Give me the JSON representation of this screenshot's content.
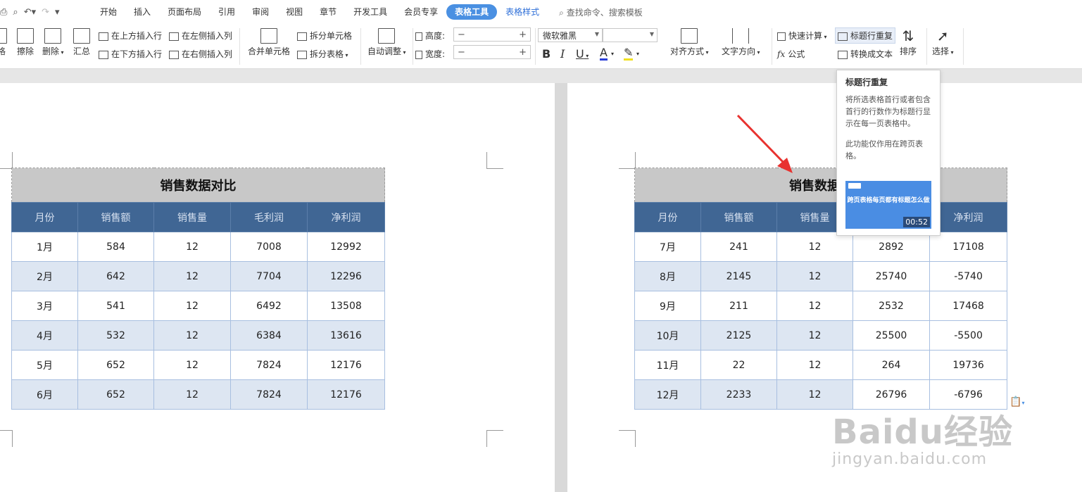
{
  "menubar": {
    "tabs": [
      "开始",
      "插入",
      "页面布局",
      "引用",
      "审阅",
      "视图",
      "章节",
      "开发工具",
      "会员专享",
      "表格工具",
      "表格样式"
    ],
    "active_tab": "表格工具",
    "search_text": "查找命令、搜索模板"
  },
  "ribbon": {
    "cut_label": "格",
    "erase_label": "擦除",
    "delete_label": "删除",
    "summary_label": "汇总",
    "insert_above": "在上方插入行",
    "insert_below": "在下方插入行",
    "insert_left": "在左侧插入列",
    "insert_right": "在右侧插入列",
    "merge_label": "合并单元格",
    "split_cell": "拆分单元格",
    "split_table": "拆分表格",
    "autofit": "自动调整",
    "height_label": "高度:",
    "width_label": "宽度:",
    "font_name": "微软雅黑",
    "align_label": "对齐方式",
    "text_dir_label": "文字方向",
    "quick_calc": "快速计算",
    "formula": "公式",
    "repeat_header": "标题行重复",
    "to_text": "转换成文本",
    "sort": "排序",
    "select": "选择"
  },
  "tooltip": {
    "title": "标题行重复",
    "desc": "将所选表格首行或者包含首行的行数作为标题行显示在每一页表格中。",
    "note": "此功能仅作用在跨页表格。",
    "video_text": "跨页表格每页都有标题怎么做",
    "duration": "00:52"
  },
  "table_left": {
    "title": "销售数据对比",
    "headers": [
      "月份",
      "销售额",
      "销售量",
      "毛利润",
      "净利润"
    ],
    "rows": [
      [
        "1月",
        "584",
        "12",
        "7008",
        "12992"
      ],
      [
        "2月",
        "642",
        "12",
        "7704",
        "12296"
      ],
      [
        "3月",
        "541",
        "12",
        "6492",
        "13508"
      ],
      [
        "4月",
        "532",
        "12",
        "6384",
        "13616"
      ],
      [
        "5月",
        "652",
        "12",
        "7824",
        "12176"
      ],
      [
        "6月",
        "652",
        "12",
        "7824",
        "12176"
      ]
    ]
  },
  "table_right": {
    "title": "销售数据对",
    "headers": [
      "月份",
      "销售额",
      "销售量",
      "",
      "净利润"
    ],
    "rows": [
      [
        "7月",
        "241",
        "12",
        "2892",
        "17108"
      ],
      [
        "8月",
        "2145",
        "12",
        "25740",
        "-5740"
      ],
      [
        "9月",
        "211",
        "12",
        "2532",
        "17468"
      ],
      [
        "10月",
        "2125",
        "12",
        "25500",
        "-5500"
      ],
      [
        "11月",
        "22",
        "12",
        "264",
        "19736"
      ],
      [
        "12月",
        "2233",
        "12",
        "26796",
        "-6796"
      ]
    ]
  },
  "watermark": {
    "main": "Baidu经验",
    "sub": "jingyan.baidu.com"
  },
  "colors": {
    "active_tab": "#4a90e2",
    "header_row": "#406694",
    "alt_row": "#dde6f2",
    "arrow": "#e8322f"
  }
}
